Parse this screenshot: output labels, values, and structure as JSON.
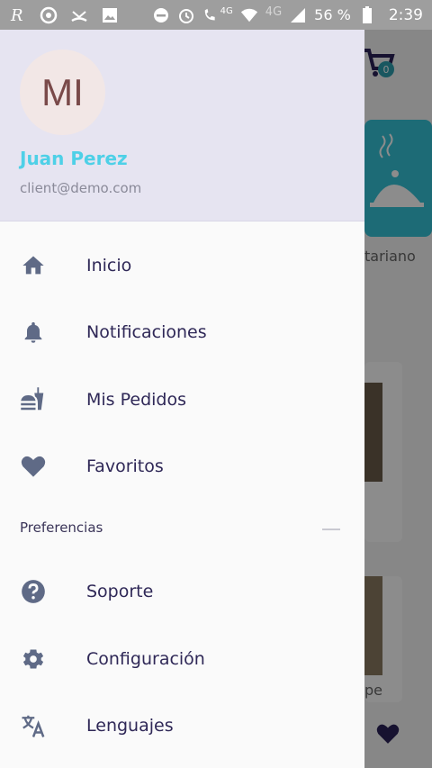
{
  "status_bar": {
    "network": "4G",
    "network2": "4G",
    "battery": "56 %",
    "time": "2:39"
  },
  "background": {
    "cart_count": "0",
    "category_label": "tariano",
    "food_label": "pe"
  },
  "drawer": {
    "avatar_initials": "MI",
    "user_name": "Juan Perez",
    "user_email": "client@demo.com",
    "menu": [
      {
        "label": "Inicio",
        "icon": "home-icon"
      },
      {
        "label": "Notificaciones",
        "icon": "bell-icon"
      },
      {
        "label": "Mis Pedidos",
        "icon": "orders-icon"
      },
      {
        "label": "Favoritos",
        "icon": "heart-icon"
      }
    ],
    "section_title": "Preferencias",
    "preferences": [
      {
        "label": "Soporte",
        "icon": "help-icon"
      },
      {
        "label": "Configuración",
        "icon": "gear-icon"
      },
      {
        "label": "Lenguajes",
        "icon": "translate-icon"
      }
    ]
  },
  "colors": {
    "accent": "#4ED0E7",
    "text_primary": "#2F2857",
    "icon": "#5F6A86",
    "header_bg": "#E6E4F1"
  }
}
